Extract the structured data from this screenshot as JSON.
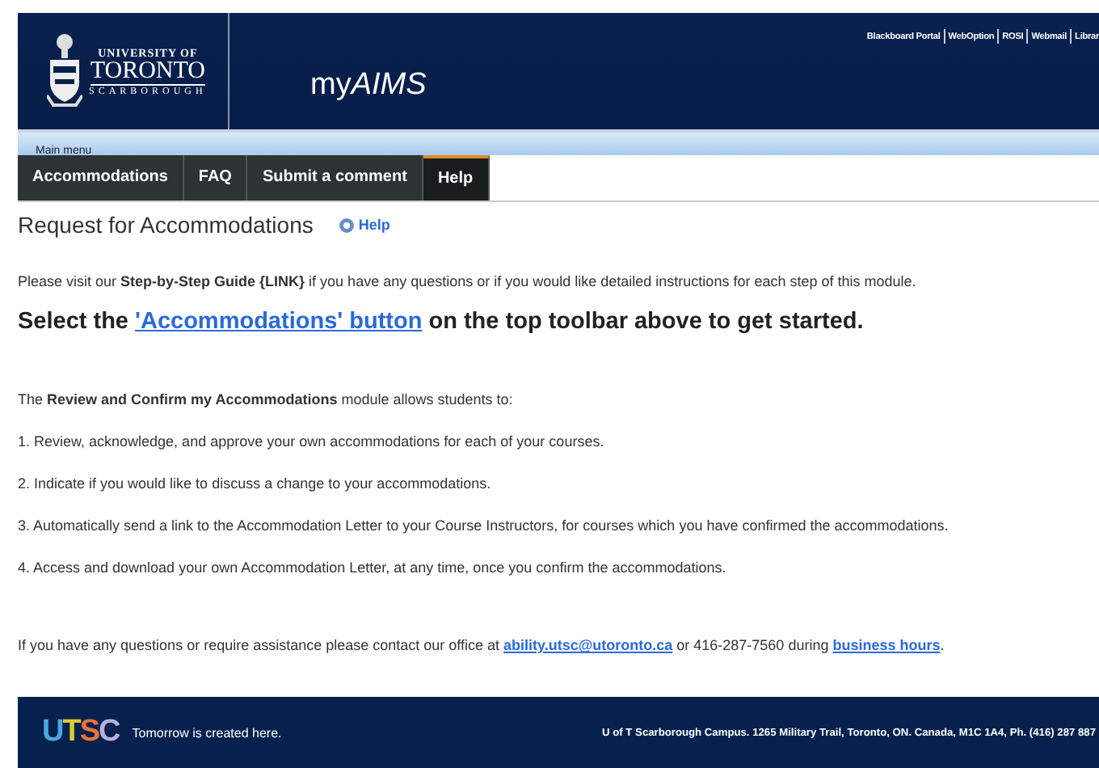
{
  "header": {
    "university_line": "UNIVERSITY OF",
    "university_name": "TORONTO",
    "campus": "SCARBOROUGH",
    "app_title": [
      {
        "text": "my",
        "italic": false
      },
      {
        "text": "AIMS",
        "italic": true
      }
    ],
    "top_links": [
      "Blackboard Portal",
      "WebOption",
      "ROSI",
      "Webmail",
      "Librar"
    ]
  },
  "menu_label": "Main menu",
  "tabs": [
    {
      "label": "Accommodations",
      "selected": false
    },
    {
      "label": "FAQ",
      "selected": false
    },
    {
      "label": "Submit a comment",
      "selected": false
    },
    {
      "label": "Help",
      "selected": true
    }
  ],
  "page_title": "Request for Accommodations",
  "help_link": "Help",
  "paragraphs": [
    {
      "kind": "intro",
      "segments": [
        {
          "kind": "plain",
          "text": "Please visit our "
        },
        {
          "kind": "bold",
          "text": "Step-by-Step Guide {LINK}"
        },
        {
          "kind": "plain",
          "text": " if you have any questions or if you would like detailed instructions for each step of this module."
        }
      ]
    },
    {
      "kind": "headline",
      "segments": [
        {
          "kind": "plain",
          "text": "Select the "
        },
        {
          "kind": "link",
          "text": "'Accommodations' button"
        },
        {
          "kind": "plain",
          "text": " on the top toolbar above to get started."
        }
      ]
    },
    {
      "kind": "lead",
      "segments": [
        {
          "kind": "plain",
          "text": "The "
        },
        {
          "kind": "bold",
          "text": "Review and Confirm my Accommodations"
        },
        {
          "kind": "plain",
          "text": " module allows students to:"
        }
      ]
    },
    {
      "kind": "item",
      "segments": [
        {
          "kind": "plain",
          "text": "1. Review, acknowledge, and approve your own accommodations for each of your courses."
        }
      ]
    },
    {
      "kind": "item",
      "segments": [
        {
          "kind": "plain",
          "text": "2. Indicate if you would like to discuss a change to your accommodations."
        }
      ]
    },
    {
      "kind": "item",
      "segments": [
        {
          "kind": "plain",
          "text": "3. Automatically send a link to the Accommodation Letter to your Course Instructors, for courses which you have confirmed the accommodations."
        }
      ]
    },
    {
      "kind": "item",
      "segments": [
        {
          "kind": "plain",
          "text": "4. Access and download your own Accommodation Letter, at any time, once you confirm the accommodations."
        }
      ]
    },
    {
      "kind": "contact",
      "segments": [
        {
          "kind": "plain",
          "text": "If you have any questions or require assistance please contact our office at "
        },
        {
          "kind": "link",
          "text": "ability.utsc@utoronto.ca"
        },
        {
          "kind": "plain",
          "text": " or 416-287-7560 during "
        },
        {
          "kind": "link",
          "text": "business hours"
        },
        {
          "kind": "plain",
          "text": "."
        }
      ]
    }
  ],
  "footer": {
    "logo": "UTSC",
    "tagline": "Tomorrow is created here.",
    "address": "U of T Scarborough Campus. 1265 Military Trail, Toronto, ON. Canada, M1C 1A4, Ph. (416) 287 887"
  }
}
